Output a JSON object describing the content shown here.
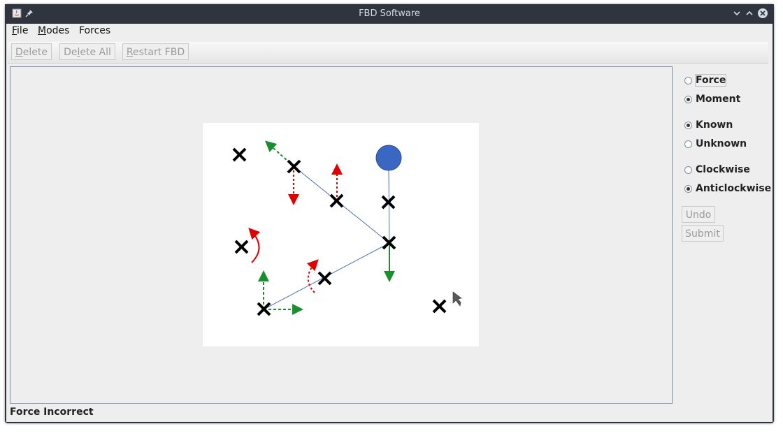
{
  "window": {
    "title": "FBD Software"
  },
  "menu": [
    {
      "mnemonic": "F",
      "rest": "ile"
    },
    {
      "mnemonic": "M",
      "rest": "odes"
    },
    {
      "mnemonic": "",
      "rest": "Forces"
    }
  ],
  "toolbar": {
    "delete_mnemonic": "D",
    "delete_rest": "elete",
    "delete_all_pre": "De",
    "delete_all_mnemonic": "l",
    "delete_all_rest": "ete All",
    "restart_mnemonic": "R",
    "restart_rest": "estart FBD"
  },
  "options": {
    "type_force": "Force",
    "type_moment": "Moment",
    "type_selected": "Moment",
    "known": "Known",
    "unknown": "Unknown",
    "known_selected": "Known",
    "clockwise": "Clockwise",
    "anticlockwise": "Anticlockwise",
    "direction_selected": "Anticlockwise",
    "undo": "Undo",
    "submit": "Submit"
  },
  "status": "Force Incorrect",
  "colors": {
    "known_force": "#1a8f2e",
    "unknown_force": "#e00000",
    "member_line": "#4a72b8",
    "pin_circle": "#3a67c2"
  }
}
